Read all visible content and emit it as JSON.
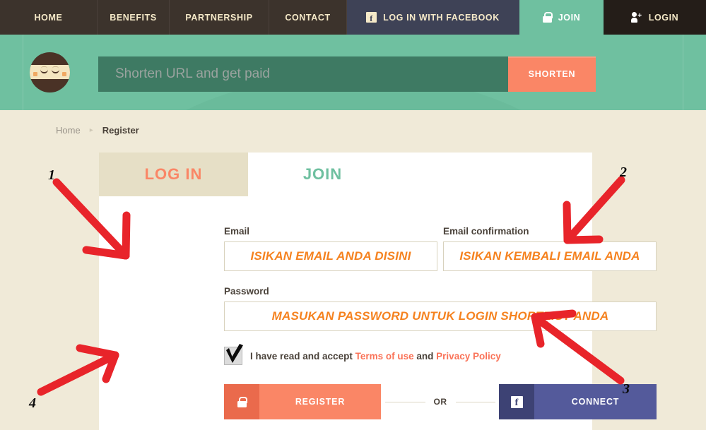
{
  "nav": {
    "items": [
      {
        "label": "HOME",
        "icon": null
      },
      {
        "label": "BENEFITS",
        "icon": null
      },
      {
        "label": "PARTNERSHIP",
        "icon": null
      },
      {
        "label": "CONTACT",
        "icon": null
      },
      {
        "label": "LOG IN WITH FACEBOOK",
        "icon": "facebook-icon"
      },
      {
        "label": "JOIN",
        "icon": "lock-icon"
      },
      {
        "label": "LOGIN",
        "icon": "person-add-icon"
      }
    ]
  },
  "hero": {
    "mascot_icon": "ninja-mascot-icon",
    "url_placeholder": "Shorten URL and get paid",
    "url_value": "",
    "shorten_label": "SHORTEN"
  },
  "breadcrumb": {
    "home": "Home",
    "separator": "▸",
    "current": "Register"
  },
  "card": {
    "tabs": [
      {
        "label": "LOG IN",
        "active": false
      },
      {
        "label": "JOIN",
        "active": true
      }
    ],
    "fields": {
      "email_label": "Email",
      "email_value": "ISIKAN EMAIL ANDA DISINI",
      "email_confirmation_label": "Email confirmation",
      "email_confirmation_value": "ISIKAN KEMBALI EMAIL ANDA",
      "password_label": "Password",
      "password_value": "MASUKAN PASSWORD UNTUK LOGIN SHORTE.ST ANDA"
    },
    "terms": {
      "checked": true,
      "prefix": "I have read and accept",
      "terms_link": "Terms of use",
      "conjunction": "and",
      "privacy_link": "Privacy Policy"
    },
    "actions": {
      "register_label": "REGISTER",
      "register_icon": "lock-icon",
      "or_label": "OR",
      "connect_label": "CONNECT",
      "connect_icon": "facebook-icon"
    }
  },
  "annotations": {
    "numbers": [
      "1",
      "2",
      "3",
      "4"
    ],
    "arrow_color": "#e8242a",
    "number_color": "#0b0b0b"
  },
  "colors": {
    "nav_bg": "#3c332c",
    "nav_facebook_bg": "#3e4256",
    "nav_join_bg": "#6fc0a0",
    "nav_login_bg": "#241d18",
    "hero_bg": "#6fc0a0",
    "page_bg": "#f0ead8",
    "card_bg": "#ffffff",
    "accent_coral": "#fa8666",
    "accent_teal": "#6fc0a0",
    "input_text_orange": "#f5821f",
    "connect_indigo": "#545a9b"
  }
}
